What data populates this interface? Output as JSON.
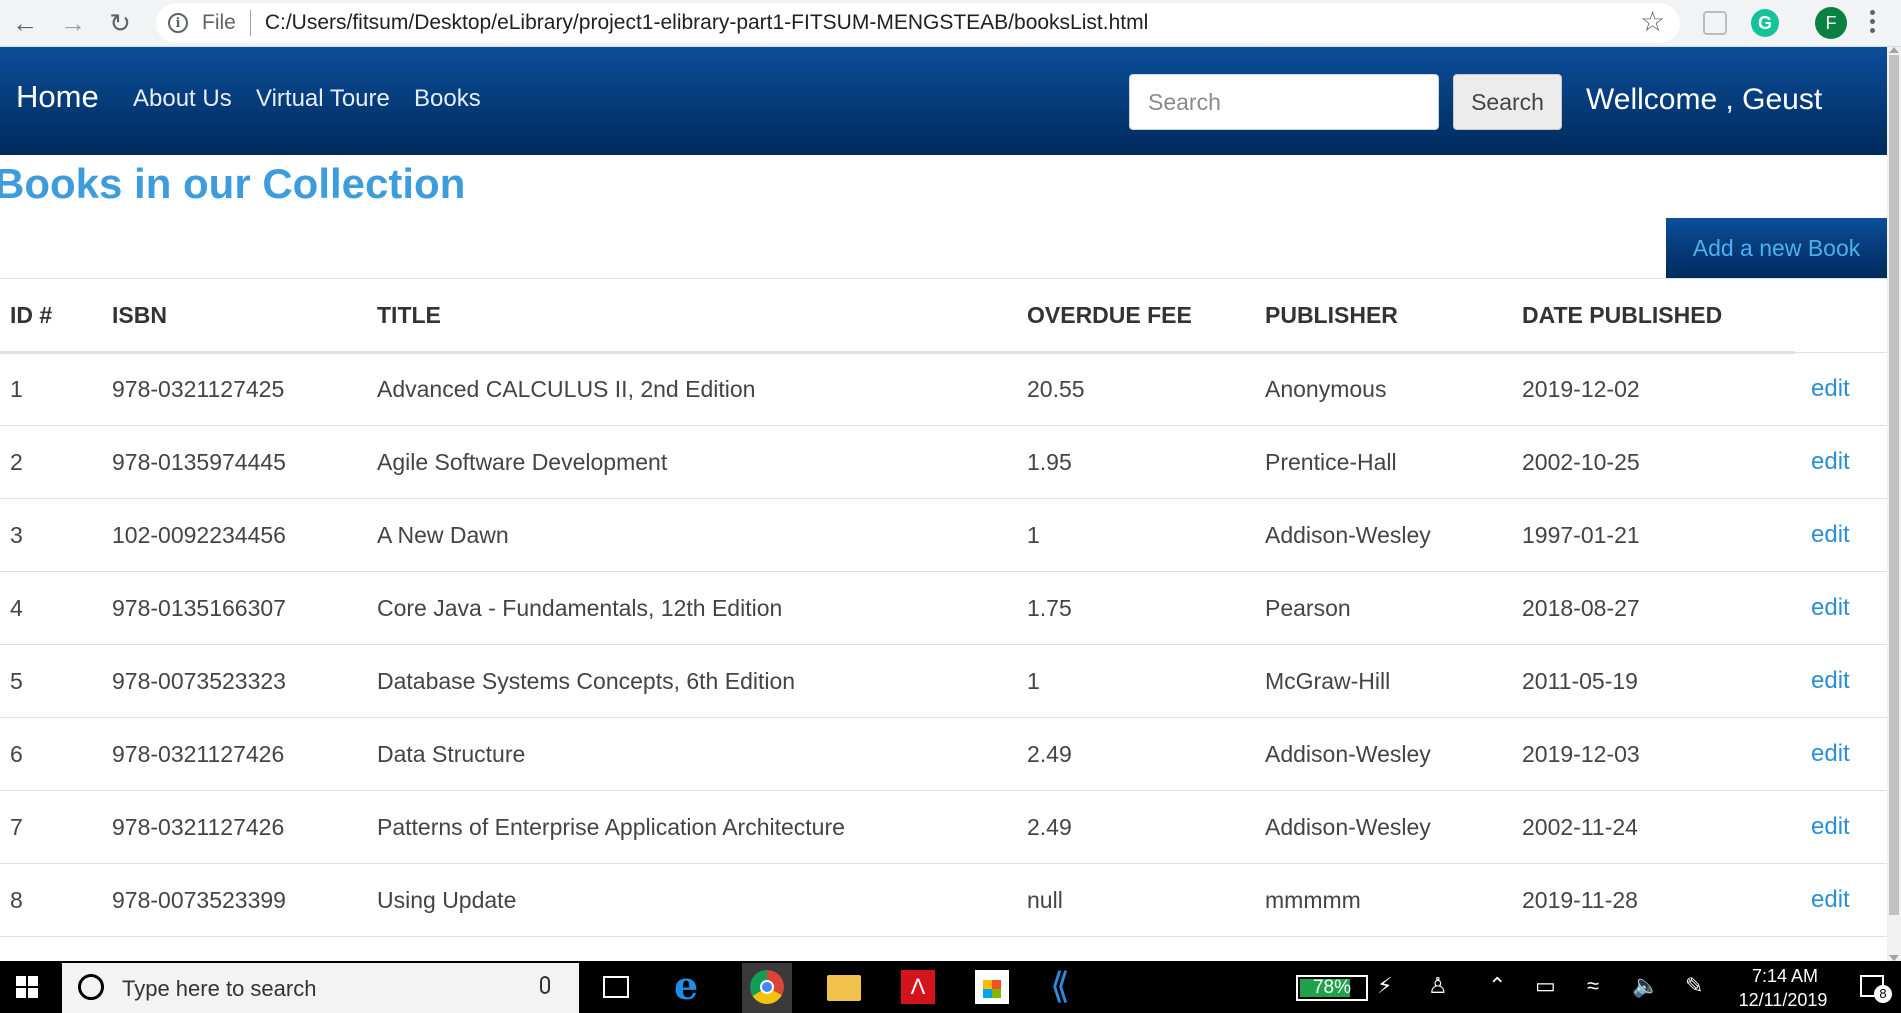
{
  "browser": {
    "scheme_label": "File",
    "url": "C:/Users/fitsum/Desktop/eLibrary/project1-elibrary-part1-FITSUM-MENGSTEAB/booksList.html",
    "profile_initial": "F",
    "grammarly_letter": "G"
  },
  "navbar": {
    "brand": "Home",
    "links": [
      "About Us",
      "Virtual Toure",
      "Books"
    ],
    "search_placeholder": "Search",
    "search_button": "Search",
    "welcome": "Wellcome , Geust",
    "accent_color": "#0b4e99"
  },
  "page": {
    "title": "Books in our Collection",
    "add_button": "Add a new Book"
  },
  "table": {
    "headers": [
      "ID #",
      "ISBN",
      "TITLE",
      "OVERDUE FEE",
      "PUBLISHER",
      "DATE PUBLISHED"
    ],
    "edit_label": "edit",
    "rows": [
      [
        "1",
        "978-0321127425",
        "Advanced CALCULUS II, 2nd Edition",
        "20.55",
        "Anonymous",
        "2019-12-02"
      ],
      [
        "2",
        "978-0135974445",
        "Agile Software Development",
        "1.95",
        "Prentice-Hall",
        "2002-10-25"
      ],
      [
        "3",
        "102-0092234456",
        "A New Dawn",
        "1",
        "Addison-Wesley",
        "1997-01-21"
      ],
      [
        "4",
        "978-0135166307",
        "Core Java - Fundamentals, 12th Edition",
        "1.75",
        "Pearson",
        "2018-08-27"
      ],
      [
        "5",
        "978-0073523323",
        "Database Systems Concepts, 6th Edition",
        "1",
        "McGraw-Hill",
        "2011-05-19"
      ],
      [
        "6",
        "978-0321127426",
        "Data Structure",
        "2.49",
        "Addison-Wesley",
        "2019-12-03"
      ],
      [
        "7",
        "978-0321127426",
        "Patterns of Enterprise Application Architecture",
        "2.49",
        "Addison-Wesley",
        "2002-11-24"
      ],
      [
        "8",
        "978-0073523399",
        "Using Update",
        "null",
        "mmmmm",
        "2019-11-28"
      ]
    ]
  },
  "taskbar": {
    "search_text": "Type here to search",
    "battery_level": 0.78,
    "battery_text": "78%",
    "time": "7:14 AM",
    "date": "12/11/2019",
    "notification_count": "8"
  }
}
